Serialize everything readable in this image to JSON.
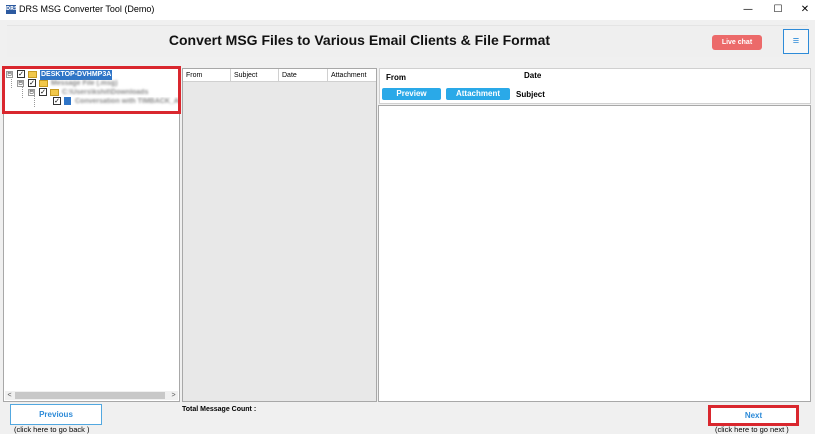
{
  "window": {
    "title": "DRS MSG Converter Tool (Demo)",
    "app_icon_text": "DRS",
    "controls": {
      "minimize": "—",
      "maximize": "☐",
      "close": "✕"
    }
  },
  "header": {
    "title": "Convert MSG Files to Various Email Clients & File Format",
    "live_chat_label": "Live chat",
    "menu_glyph": "≡"
  },
  "tree": {
    "nodes": [
      {
        "label": "DESKTOP-DVHMP3A",
        "expander": "⊟",
        "checked": "✓",
        "icon": "folder-icon"
      },
      {
        "label": "Message File (.msg)",
        "expander": "⊟",
        "checked": "✓",
        "icon": "folder-icon"
      },
      {
        "label": "C:\\Users\\kshit\\Downloads",
        "expander": "⊟",
        "checked": "✓",
        "icon": "folder-icon"
      },
      {
        "label": "Conversation with TIMBACK_Ad",
        "expander": "",
        "checked": "✓",
        "icon": "file-icon"
      }
    ],
    "scroll_left": "<",
    "scroll_right": ">"
  },
  "message_list": {
    "columns": [
      "From",
      "Subject",
      "Date",
      "Attachment"
    ]
  },
  "preview": {
    "from_label": "From",
    "date_label": "Date",
    "subject_label": "Subject",
    "preview_tab": "Preview",
    "attachment_tab": "Attachment"
  },
  "footer": {
    "previous_label": "Previous",
    "previous_hint": "(click here to  go back )",
    "total_count_label": "Total Message Count :",
    "next_label": "Next",
    "next_hint": "(click here to  go next )"
  },
  "colors": {
    "accent_blue": "#2aa9e8",
    "live_chat": "#ec6a6a",
    "highlight_red": "#d9272e"
  }
}
